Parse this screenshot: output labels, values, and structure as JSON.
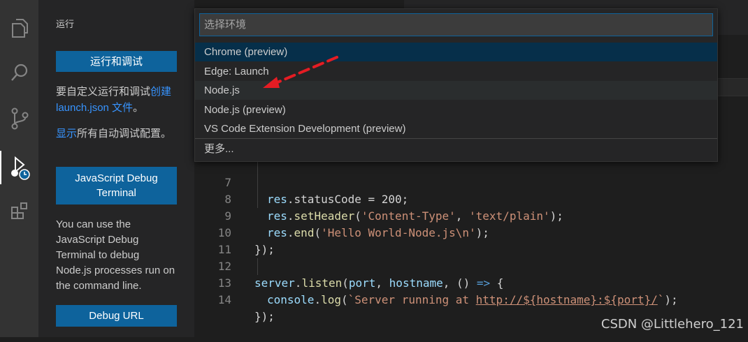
{
  "activity_bar": {
    "icons": [
      "explorer-icon",
      "search-icon",
      "source-control-icon",
      "run-debug-icon",
      "extensions-icon"
    ]
  },
  "sidebar": {
    "title": "运行",
    "run_debug_button": "运行和调试",
    "custom_text_prefix": "要自定义运行和调试",
    "custom_link": "创建 launch.json 文件",
    "custom_text_suffix": "。",
    "show_link": "显示",
    "show_text_suffix": "所有自动调试配置。",
    "js_debug_terminal_button": "JavaScript Debug Terminal",
    "js_debug_description": "You can use the JavaScript Debug Terminal to debug Node.js processes run on the command line.",
    "debug_url_button": "Debug URL"
  },
  "quick_pick": {
    "placeholder": "选择环境",
    "items": [
      {
        "label": "Chrome (preview)"
      },
      {
        "label": "Edge: Launch"
      },
      {
        "label": "Node.js"
      },
      {
        "label": "Node.js (preview)"
      },
      {
        "label": "VS Code Extension Development (preview)"
      }
    ],
    "more": "更多..."
  },
  "editor": {
    "line_numbers": [
      "7",
      "8",
      "9",
      "10",
      "11",
      "12",
      "13",
      "14"
    ],
    "lines": {
      "l7": {
        "prefix": "res",
        "rest": ".statusCode = 200;"
      },
      "l8": {
        "obj": "res",
        "dot": ".",
        "fn": "setHeader",
        "open": "(",
        "s1": "'Content-Type'",
        "comma": ", ",
        "s2": "'text/plain'",
        "close": ");"
      },
      "l9": {
        "obj": "res",
        "dot": ".",
        "fn": "end",
        "open": "(",
        "s1": "'Hello World-Node.js\\n'",
        "close": ");"
      },
      "l10": "});",
      "l12": {
        "obj": "server",
        "dot": ".",
        "fn": "listen",
        "open": "(",
        "a1": "port",
        "comma1": ", ",
        "a2": "hostname",
        "comma2": ", () ",
        "arrow": "=>",
        "brace": " {"
      },
      "l13": {
        "obj": "console",
        "dot": ".",
        "fn": "log",
        "open": "(",
        "s_start": "`Server running at ",
        "url": "http://${hostname}:${port}/",
        "s_end": "`",
        "close": ");"
      },
      "l14": "});"
    }
  },
  "watermark": "CSDN @Littlehero_121",
  "colors": {
    "accent_button": "#0e639c",
    "link": "#3794ff",
    "selection": "#062f4a",
    "arrow": "#e51c23"
  }
}
